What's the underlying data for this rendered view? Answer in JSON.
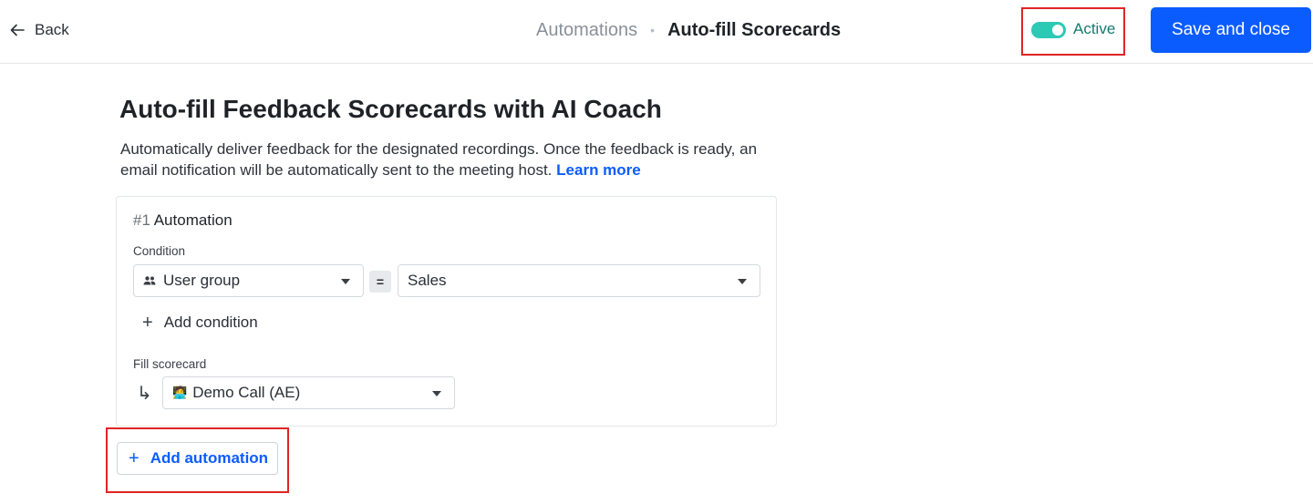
{
  "header": {
    "back_label": "Back",
    "breadcrumb_parent": "Automations",
    "breadcrumb_separator": "•",
    "breadcrumb_current": "Auto-fill Scorecards",
    "status_label": "Active",
    "status_on": true,
    "save_label": "Save and close"
  },
  "main": {
    "title": "Auto-fill Feedback Scorecards with AI Coach",
    "description": "Automatically deliver feedback for the designated recordings. Once the feedback is ready, an email notification will be automatically sent to the meeting host.",
    "learn_more": "Learn more"
  },
  "automation": {
    "number": "#1",
    "title": "Automation",
    "condition_label": "Condition",
    "condition_field": "User group",
    "condition_operator": "=",
    "condition_value": "Sales",
    "add_condition": "Add condition",
    "fill_label": "Fill scorecard",
    "scorecard_emoji": "🧑‍💻",
    "scorecard": "Demo Call (AE)"
  },
  "add_automation": "Add automation",
  "colors": {
    "accent": "#0b5cff",
    "toggle": "#2cc9b5",
    "active_text": "#127a6c",
    "highlight": "#e02424"
  },
  "icons": {
    "back": "arrow-left-icon",
    "user_group": "users-icon",
    "caret": "caret-down-icon",
    "plus": "plus-icon",
    "fill_arrow": "arrow-return-right-icon"
  }
}
